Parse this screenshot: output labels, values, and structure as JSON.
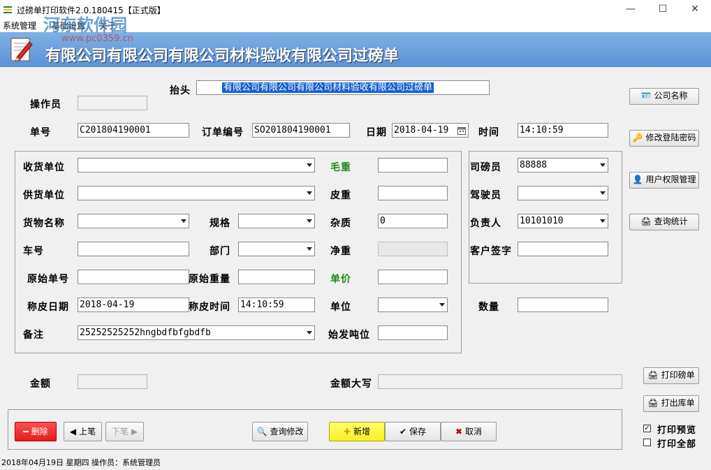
{
  "window": {
    "title": "过磅单打印软件2.0.180415【正式版】",
    "minimize": "—",
    "maximize": "☐",
    "close": "✕"
  },
  "menu": {
    "items": [
      "系统管理",
      "基础设置",
      "关于"
    ]
  },
  "watermark": {
    "name": "河东软件园",
    "url": "www.pc0359.cn"
  },
  "banner": {
    "title": "有限公司有限公司有限公司材料验收有限公司过磅单"
  },
  "form": {
    "taitou_label": "抬头",
    "taitou_value": "有限公司有限公司有限公司材料验收有限公司过磅单",
    "operator_label": "操作员",
    "operator_value": "",
    "order_no_label": "单号",
    "order_no_value": "C201804190001",
    "po_no_label": "订单编号",
    "po_no_value": "SO201804190001",
    "date_label": "日期",
    "date_value": "2018-04-19",
    "time_label": "时间",
    "time_value": "14:10:59",
    "receiver_label": "收货单位",
    "receiver_value": "",
    "supplier_label": "供货单位",
    "supplier_value": "",
    "goods_label": "货物名称",
    "goods_value": "",
    "spec_label": "规格",
    "spec_value": "",
    "plate_label": "车号",
    "plate_value": "",
    "dept_label": "部门",
    "dept_value": "",
    "orig_no_label": "原始单号",
    "orig_no_value": "",
    "orig_weight_label": "原始重量",
    "orig_weight_value": "",
    "tare_date_label": "称皮日期",
    "tare_date_value": "2018-04-19",
    "tare_time_label": "称皮时间",
    "tare_time_value": "14:10:59",
    "remark_label": "备注",
    "remark_value": "25252525252hngbdfbfgbdfb",
    "gross_label": "毛重",
    "gross_value": "",
    "tare_label": "皮重",
    "tare_value": "",
    "impurity_label": "杂质",
    "impurity_value": "0",
    "net_label": "净重",
    "net_value": "",
    "price_label": "单价",
    "price_value": "",
    "unit_label": "单位",
    "unit_value": "",
    "start_ton_label": "始发吨位",
    "start_ton_value": "",
    "weigher_label": "司磅员",
    "weigher_value": "88888",
    "driver_label": "驾驶员",
    "driver_value": "",
    "manager_label": "负责人",
    "manager_value": "10101010",
    "sign_label": "客户签字",
    "sign_value": "",
    "qty_label": "数量",
    "qty_value": "",
    "amount_label": "金额",
    "amount_value": "",
    "amount_cn_label": "金额大写",
    "amount_cn_value": ""
  },
  "side_buttons": {
    "company": "公司名称",
    "password": "修改登陆密码",
    "permission": "用户权限管理",
    "query_stats": "查询统计",
    "print_ticket": "打印磅单",
    "print_out": "打出库单"
  },
  "bottom_buttons": {
    "delete": "删除",
    "prev": "上笔",
    "next": "下笔",
    "query_edit": "查询修改",
    "add": "新增",
    "save": "保存",
    "cancel": "取消"
  },
  "options": {
    "print_preview": "打印预览",
    "print_preview_checked": "✓",
    "print_all": "打印全部",
    "print_all_checked": ""
  },
  "status_bar": {
    "text": "2018年04月19日   星期四  操作员：系统管理员"
  }
}
